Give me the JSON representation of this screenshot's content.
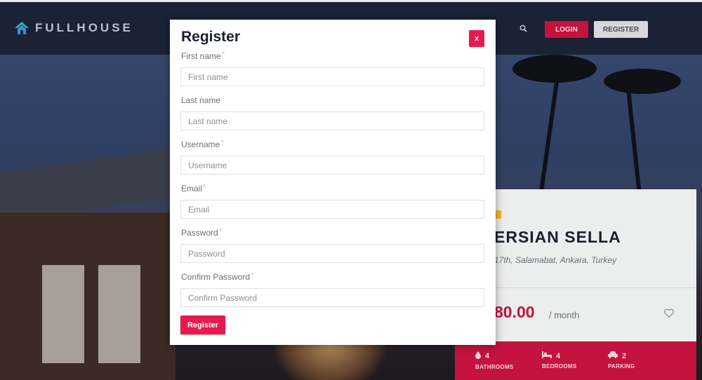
{
  "header": {
    "logo_text": "FULLHOUSE",
    "login_label": "LOGIN",
    "register_label": "REGISTER",
    "search_icon": "search-icon"
  },
  "property_card": {
    "title": "ERSIAN SELLA",
    "address": "17th, Salamabat, Ankara, Turkey",
    "price": "80.00",
    "price_period": "/ month",
    "stats": [
      {
        "icon": "water-drop-icon",
        "value": "4",
        "label": "BATHROOMS"
      },
      {
        "icon": "bed-icon",
        "value": "4",
        "label": "BEDROOMS"
      },
      {
        "icon": "car-icon",
        "value": "2",
        "label": "PARKING"
      }
    ]
  },
  "modal": {
    "title": "Register",
    "close_label": "x",
    "fields": [
      {
        "label": "First name",
        "required": true,
        "placeholder": "First name"
      },
      {
        "label": "Last name",
        "required": false,
        "placeholder": "Last name"
      },
      {
        "label": "Username",
        "required": true,
        "placeholder": "Username"
      },
      {
        "label": "Email",
        "required": true,
        "placeholder": "Email"
      },
      {
        "label": "Password",
        "required": true,
        "placeholder": "Password"
      },
      {
        "label": "Confirm Password",
        "required": true,
        "placeholder": "Confirm Password"
      }
    ],
    "required_mark": "*",
    "submit_label": "Register"
  },
  "colors": {
    "accent": "#e8194f",
    "nav_bg": "#1b2236",
    "badge": "#f2b233"
  }
}
